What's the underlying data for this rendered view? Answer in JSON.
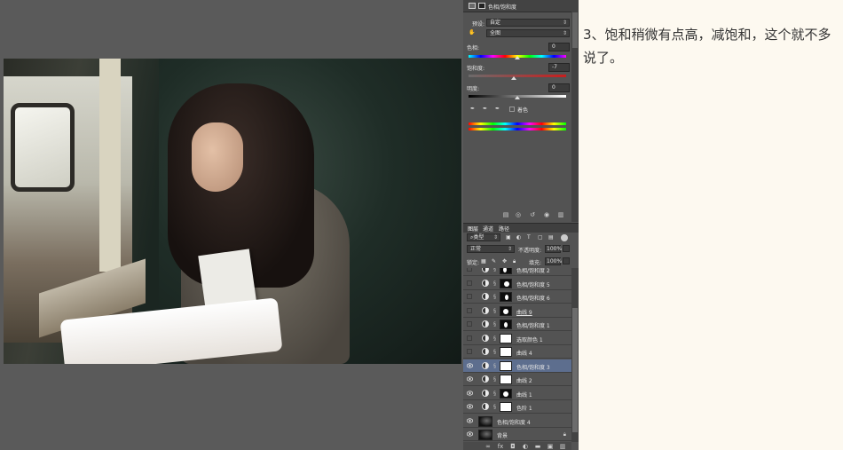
{
  "properties": {
    "title": "色相/饱和度",
    "preset_label": "预设:",
    "preset_value": "自定",
    "range_value": "全图",
    "hue_label": "色相:",
    "hue_value": "0",
    "saturation_label": "饱和度:",
    "saturation_value": "-7",
    "lightness_label": "明度:",
    "lightness_value": "0",
    "colorize_label": "着色"
  },
  "layers_panel": {
    "tabs": [
      "图层",
      "通道",
      "路径"
    ],
    "filter_kind": "类型",
    "blend_mode": "正常",
    "opacity_label": "不透明度:",
    "opacity_value": "100%",
    "lock_label": "锁定:",
    "fill_label": "填充:",
    "fill_value": "100%",
    "layers": [
      {
        "name": "色相/饱和度 2",
        "visible": false,
        "mask": "dark",
        "selected": false
      },
      {
        "name": "色相/饱和度 5",
        "visible": false,
        "mask": "dark",
        "selected": false
      },
      {
        "name": "色相/饱和度 6",
        "visible": false,
        "mask": "dark",
        "selected": false
      },
      {
        "name": "曲线 9",
        "visible": false,
        "mask": "dark",
        "selected": false
      },
      {
        "name": "色相/饱和度 1",
        "visible": false,
        "mask": "dark",
        "selected": false
      },
      {
        "name": "选取颜色 1",
        "visible": false,
        "mask": "white",
        "selected": false
      },
      {
        "name": "曲线 4",
        "visible": false,
        "mask": "white",
        "selected": false
      },
      {
        "name": "色相/饱和度 3",
        "visible": true,
        "mask": "white",
        "selected": true
      },
      {
        "name": "曲线 2",
        "visible": true,
        "mask": "white",
        "selected": false
      },
      {
        "name": "曲线 1",
        "visible": true,
        "mask": "dark",
        "selected": false
      },
      {
        "name": "色阶 1",
        "visible": true,
        "mask": "white",
        "selected": false
      },
      {
        "name": "色相/饱和度 4",
        "visible": true,
        "mask": "photo",
        "selected": false
      },
      {
        "name": "背景",
        "visible": true,
        "mask": "photo",
        "selected": false
      }
    ]
  },
  "note": {
    "text": "3、饱和稍微有点高，减饱和，这个就不多说了。"
  },
  "colors": {
    "canvas_bg": "#5a5a5a",
    "panel_bg": "#535353",
    "selected_layer": "#5d6e8e",
    "page_bg": "#fdf9f0"
  }
}
